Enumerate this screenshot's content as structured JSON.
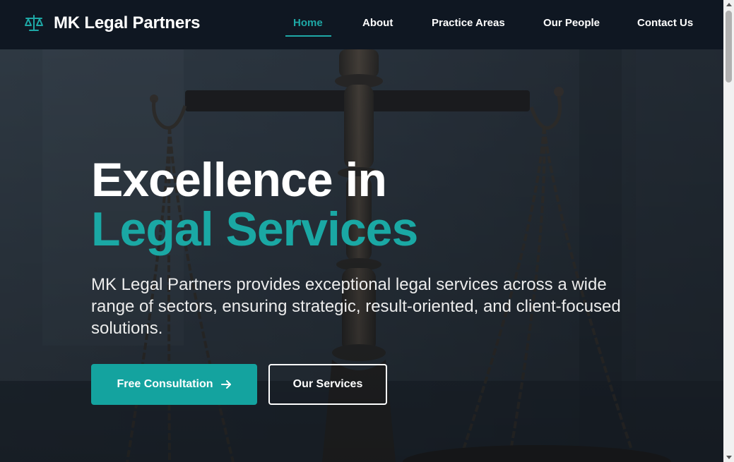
{
  "brand": {
    "name": "MK Legal Partners",
    "logo_icon": "scale-of-justice-icon",
    "accent": "#1ea8a6"
  },
  "nav": {
    "items": [
      {
        "label": "Home",
        "active": true
      },
      {
        "label": "About",
        "active": false
      },
      {
        "label": "Practice Areas",
        "active": false
      },
      {
        "label": "Our People",
        "active": false
      },
      {
        "label": "Contact Us",
        "active": false
      }
    ]
  },
  "hero": {
    "title_line1": "Excellence in",
    "title_line2": "Legal Services",
    "description": "MK Legal Partners provides exceptional legal services across a wide range of sectors, ensuring strategic, result-oriented, and client-focused solutions.",
    "primary_button": "Free Consultation",
    "primary_icon": "arrow-right-icon",
    "secondary_button": "Our Services",
    "background_image": "scales-of-justice-photo"
  },
  "colors": {
    "navbar_bg": "#0f1722",
    "accent": "#14a39f",
    "text": "#ffffff"
  }
}
